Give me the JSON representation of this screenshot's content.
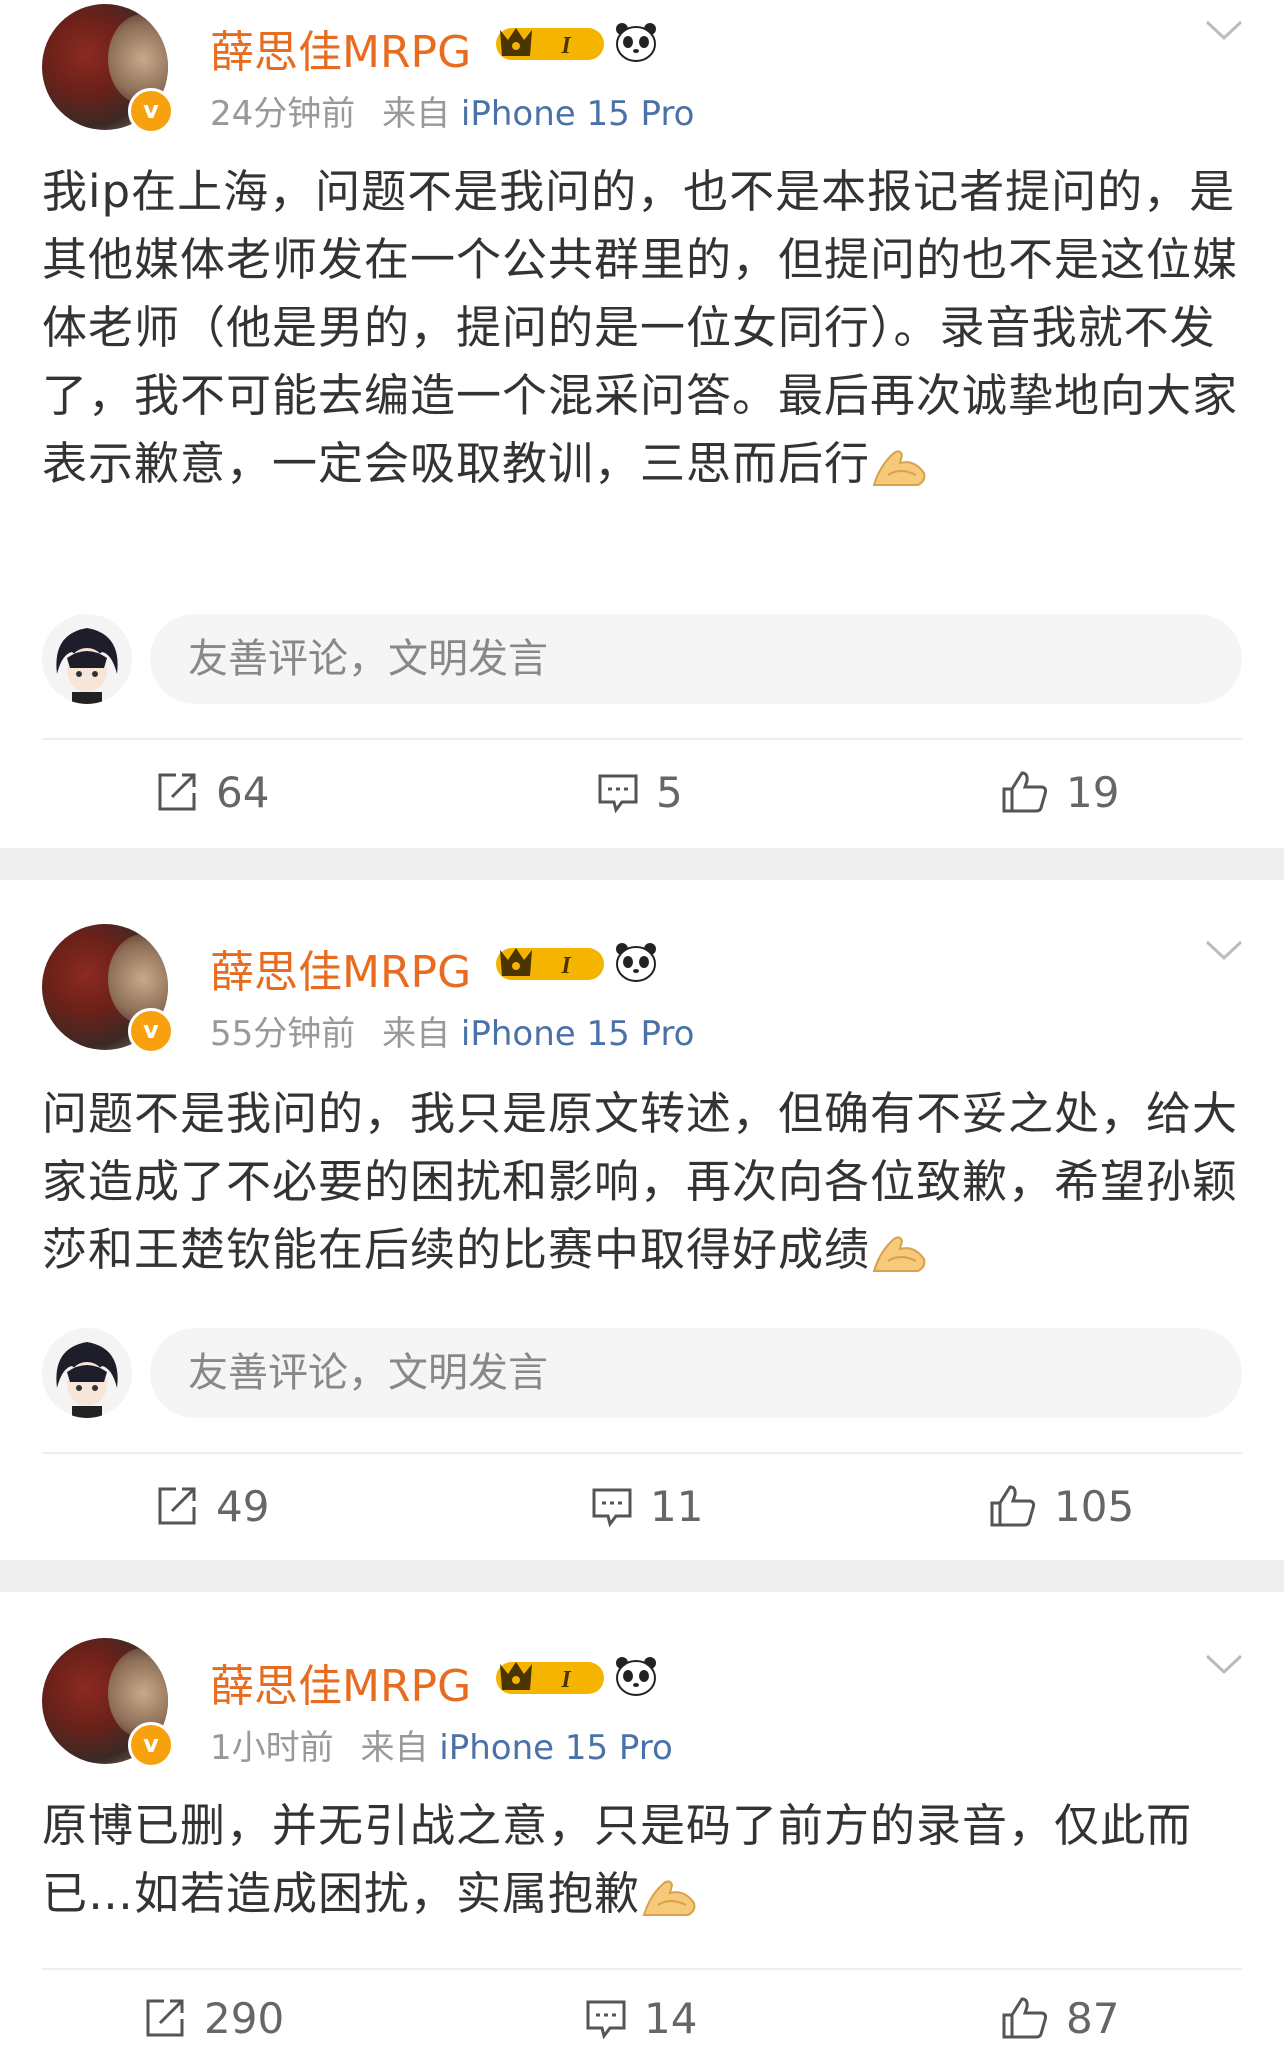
{
  "posts": [
    {
      "author": "薛思佳MRPG",
      "time": "24分钟前",
      "source_prefix": "来自",
      "source": "iPhone 15 Pro",
      "text": "我ip在上海，问题不是我问的，也不是本报记者提问的，是其他媒体老师发在一个公共群里的，但提问的也不是这位媒体老师（他是男的，提问的是一位女同行）。录音我就不发了，我不可能去编造一个混采问答。最后再次诚挚地向大家表示歉意，一定会吸取教训，三思而后行",
      "comment_placeholder": "友善评论，文明发言",
      "reposts": "64",
      "comments": "5",
      "likes": "19"
    },
    {
      "author": "薛思佳MRPG",
      "time": "55分钟前",
      "source_prefix": "来自",
      "source": "iPhone 15 Pro",
      "text": "问题不是我问的，我只是原文转述，但确有不妥之处，给大家造成了不必要的困扰和影响，再次向各位致歉，希望孙颖莎和王楚钦能在后续的比赛中取得好成绩",
      "comment_placeholder": "友善评论，文明发言",
      "reposts": "49",
      "comments": "11",
      "likes": "105"
    },
    {
      "author": "薛思佳MRPG",
      "time": "1小时前",
      "source_prefix": "来自",
      "source": "iPhone 15 Pro",
      "text": "原博已删，并无引战之意，只是码了前方的录音，仅此而已…如若造成困扰，实属抱歉",
      "reposts": "290",
      "comments": "14",
      "likes": "87"
    }
  ],
  "badges": {
    "crown_label": "I",
    "crown_color": "#f5b400",
    "verified_mark": "v",
    "verified_color": "#f7a10f"
  },
  "icons": [
    "chevron-down-icon",
    "verified-icon",
    "crown-badge-icon",
    "panda-icon",
    "folded-hands-emoji",
    "repost-icon",
    "comment-icon",
    "like-icon"
  ]
}
